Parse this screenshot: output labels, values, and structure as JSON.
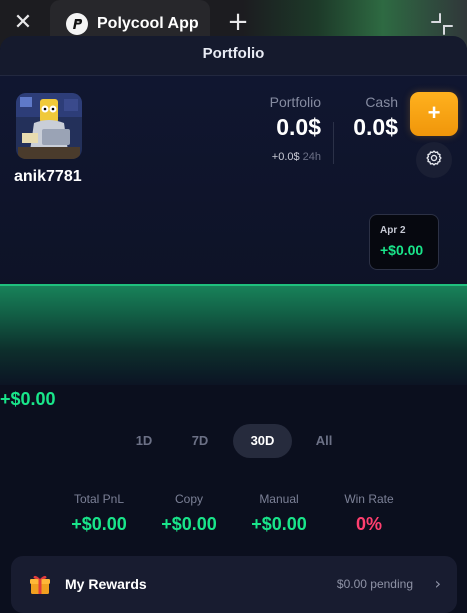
{
  "browser": {
    "close_glyph": "✕",
    "tab_title": "Polycool App",
    "new_tab_glyph": "+",
    "collapse_icon": "collapse-arrows-icon"
  },
  "header": {
    "title": "Portfolio"
  },
  "profile": {
    "username": "anik7781"
  },
  "balances": {
    "portfolio_label": "Portfolio",
    "portfolio_value": "0.0$",
    "change_value": "+0.0$",
    "change_period": "24h",
    "cash_label": "Cash",
    "cash_value": "0.0$"
  },
  "actions": {
    "add_label": "+",
    "settings_icon": "gear-icon"
  },
  "chart": {
    "tooltip_date": "Apr 2",
    "tooltip_value": "+$0.00",
    "current_value": "+$0.00",
    "line_color": "#1fc07d"
  },
  "chart_data": {
    "type": "area",
    "x": [
      "Apr 2"
    ],
    "values": [
      0.0
    ]
  },
  "ranges": {
    "options": [
      "1D",
      "7D",
      "30D",
      "All"
    ],
    "selected": "30D"
  },
  "stats": [
    {
      "label": "Total PnL",
      "value": "+$0.00"
    },
    {
      "label": "Copy",
      "value": "+$0.00"
    },
    {
      "label": "Manual",
      "value": "+$0.00"
    },
    {
      "label": "Win Rate",
      "value": "0%"
    }
  ],
  "rewards": {
    "label": "My Rewards",
    "pending": "$0.00 pending",
    "chevron": "›"
  },
  "colors": {
    "accent_orange": "#f7a414",
    "positive_green": "#19e58a",
    "negative_pink": "#ff3f6f"
  }
}
